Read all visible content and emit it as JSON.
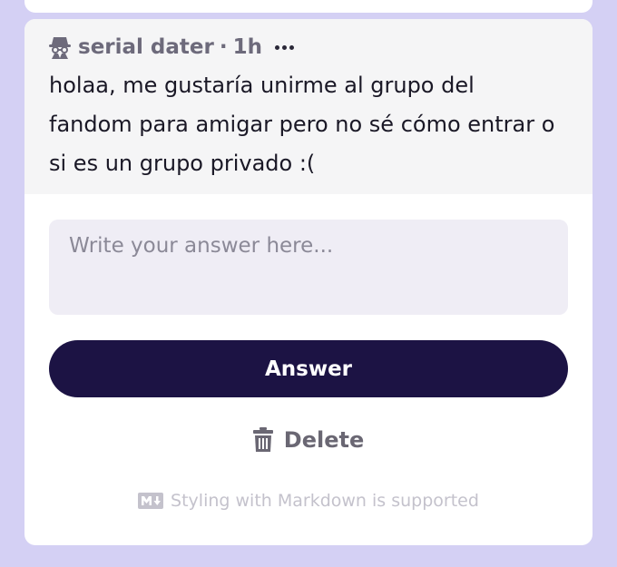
{
  "question": {
    "author": "serial dater",
    "separator": "·",
    "time_ago": "1h",
    "text": "holaa, me gustaría unirme al grupo del fandom para amigar pero no sé cómo entrar o si es un grupo privado :(",
    "author_icon": "spy-icon",
    "more_icon": "more-dots-icon"
  },
  "answer": {
    "placeholder": "Write your answer here...",
    "value": "",
    "submit_label": "Answer"
  },
  "actions": {
    "delete_label": "Delete",
    "delete_icon": "trash-icon"
  },
  "footer": {
    "markdown_note": "Styling with Markdown is supported",
    "markdown_icon": "markdown-icon"
  },
  "colors": {
    "background": "#d4d0f4",
    "card": "#ffffff",
    "question_bg": "#f5f5f6",
    "input_bg": "#efedf5",
    "primary_button": "#1c1344",
    "muted_text": "#6d6a7b"
  }
}
